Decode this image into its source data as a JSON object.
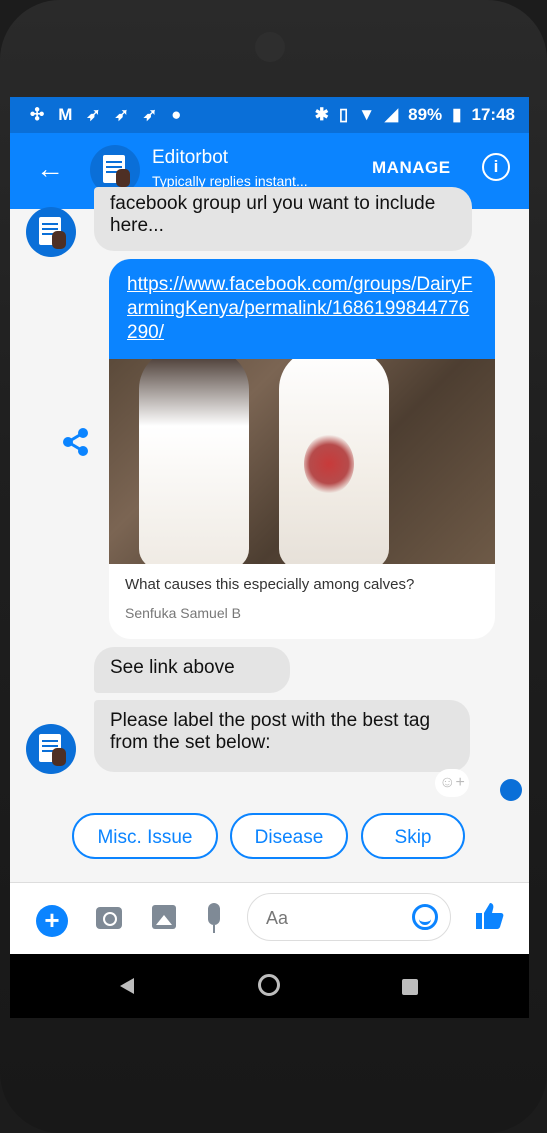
{
  "status_bar": {
    "battery": "89%",
    "time": "17:48"
  },
  "header": {
    "name": "Editorbot",
    "subtitle": "Typically replies instant...",
    "manage": "MANAGE"
  },
  "messages": {
    "top_partial": "facebook group url you want to include here...",
    "link": {
      "url": "https://www.facebook.com/groups/DairyFarmingKenya/permalink/1686199844776290/",
      "title": "What causes this especially among calves?",
      "author": "Senfuka Samuel B"
    },
    "see_link": "See link above",
    "label_prompt": "Please label the post with the best tag from the set below:"
  },
  "quick_replies": [
    "Misc. Issue",
    "Disease",
    "Skip"
  ],
  "composer": {
    "placeholder": "Aa"
  },
  "colors": {
    "accent": "#0b84ff",
    "status_bar": "#0a6fd8",
    "bubble_grey": "#e4e4e4"
  },
  "icons": [
    "back-arrow-icon",
    "info-icon",
    "share-icon",
    "plus-icon",
    "camera-icon",
    "gallery-icon",
    "mic-icon",
    "emoji-icon",
    "like-icon"
  ]
}
